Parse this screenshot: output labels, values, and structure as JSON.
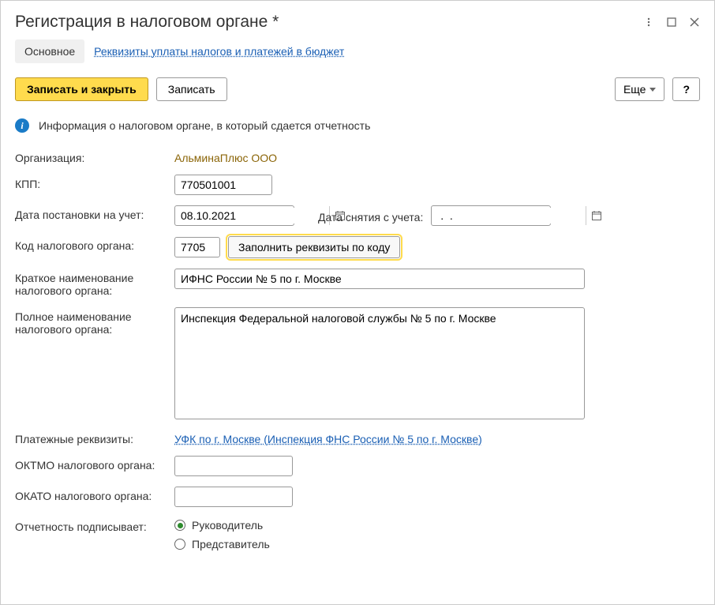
{
  "window": {
    "title": "Регистрация в налоговом органе *"
  },
  "tabs": {
    "main": "Основное",
    "requisites": "Реквизиты уплаты налогов и платежей в бюджет"
  },
  "toolbar": {
    "save_close": "Записать и закрыть",
    "save": "Записать",
    "more": "Еще",
    "help": "?"
  },
  "info": {
    "text": "Информация о налоговом органе, в который сдается отчетность"
  },
  "form": {
    "org_label": "Организация:",
    "org_value": "АльминаПлюс ООО",
    "kpp_label": "КПП:",
    "kpp_value": "770501001",
    "reg_date_label": "Дата постановки на учет:",
    "reg_date_value": "08.10.2021",
    "dereg_date_label": "Дата снятия с учета:",
    "dereg_date_value": " .  . ",
    "code_label": "Код налогового органа:",
    "code_value": "7705",
    "fill_btn": "Заполнить реквизиты по коду",
    "short_name_label": "Краткое наименование налогового органа:",
    "short_name_value": "ИФНС России № 5 по г. Москве",
    "full_name_label": "Полное наименование налогового органа:",
    "full_name_value": "Инспекция Федеральной налоговой службы № 5 по г. Москве",
    "payment_label": "Платежные реквизиты:",
    "payment_link": "УФК по г. Москве (Инспекция ФНС России № 5 по г. Москве)",
    "oktmo_label": "ОКТМО налогового органа:",
    "oktmo_value": "",
    "okato_label": "ОКАТО налогового органа:",
    "okato_value": "",
    "signer_label": "Отчетность подписывает:",
    "signer_head": "Руководитель",
    "signer_rep": "Представитель"
  }
}
